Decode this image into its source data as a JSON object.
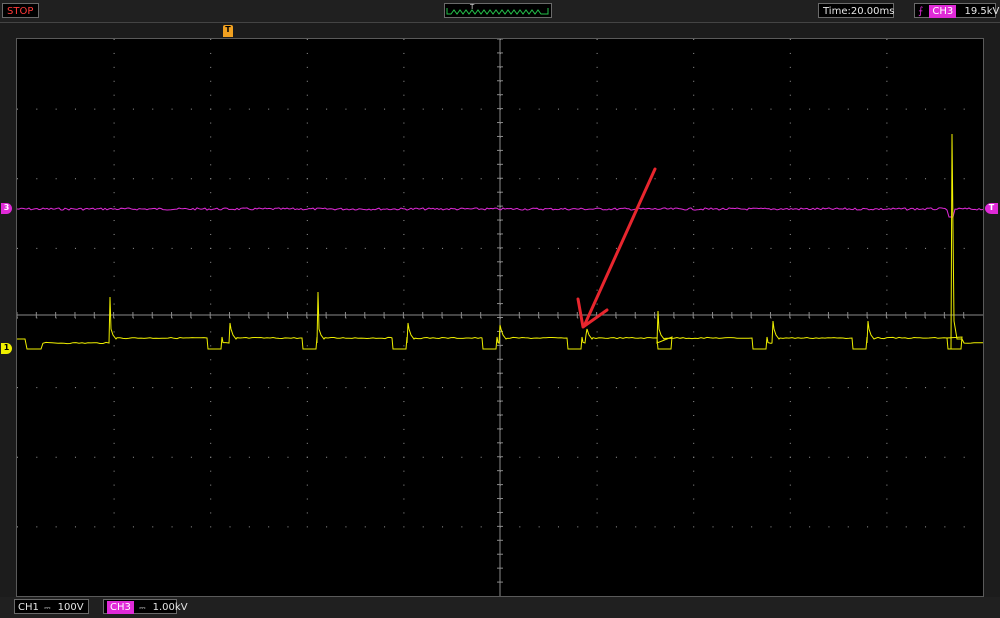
{
  "status": {
    "run_state": "STOP"
  },
  "trigger_position": {
    "label": "T"
  },
  "timebase": {
    "text": "Time:20.00ms"
  },
  "trigger": {
    "source": "CH3",
    "level": "19.5kV",
    "slope_icon": "rising-edge-icon"
  },
  "markers": {
    "trigger_pos": "T",
    "ch3_level": "3",
    "ch1_level": "1",
    "trigger_level": "T"
  },
  "channels": [
    {
      "name": "CH1",
      "coupling": "DC",
      "scale": "100V",
      "color": "#f0f000"
    },
    {
      "name": "CH3",
      "coupling": "DC",
      "scale": "1.00kV",
      "color": "#e02ad8"
    }
  ],
  "colors": {
    "ch1": "#f0f000",
    "ch3": "#e02ad8",
    "annotation_arrow": "#e8262e",
    "grid": "#9a9a9a",
    "trigger_marker": "#f0a020"
  }
}
